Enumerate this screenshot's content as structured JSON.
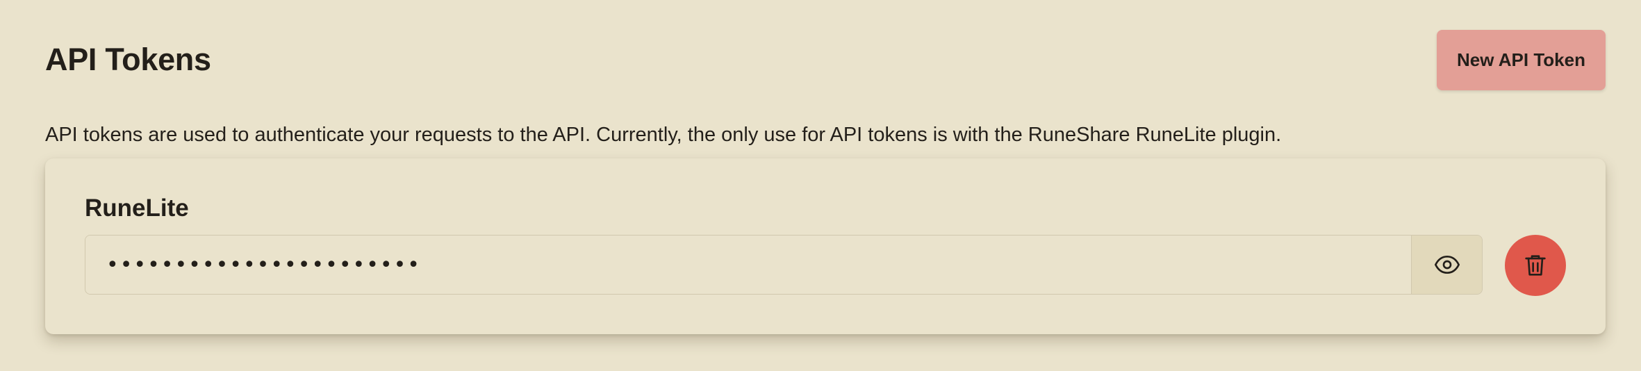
{
  "header": {
    "title": "API Tokens",
    "new_token_label": "New API Token"
  },
  "description": "API tokens are used to authenticate your requests to the API. Currently, the only use for API tokens is with the RuneShare RuneLite plugin.",
  "tokens": [
    {
      "name": "RuneLite",
      "masked_value": "•••••••••••••••••••••••",
      "visibility_icon": "eye-icon",
      "delete_icon": "trash-icon"
    }
  ],
  "colors": {
    "background": "#EAE3CC",
    "primary_button": "#E39F96",
    "danger_button": "#E0584B",
    "text": "#231F1A"
  }
}
